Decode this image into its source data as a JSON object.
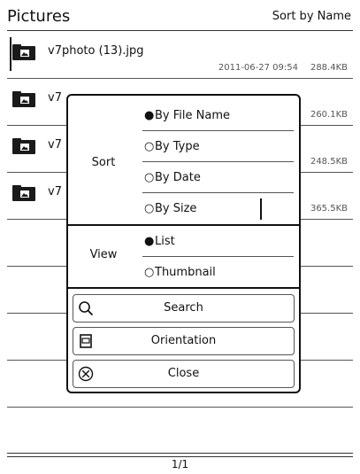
{
  "header": {
    "title": "Pictures",
    "sort_label": "Sort by Name"
  },
  "files": [
    {
      "name": "v7photo (13).jpg",
      "date": "2011-06-27 09:54",
      "size": "288.4KB"
    },
    {
      "name": "v7",
      "date": "",
      "size": "260.1KB"
    },
    {
      "name": "v7",
      "date": "",
      "size": "248.5KB"
    },
    {
      "name": "v7",
      "date": "",
      "size": "365.5KB"
    }
  ],
  "dialog": {
    "sort": {
      "label": "Sort",
      "options": [
        {
          "bullet": "●",
          "label": "By File Name",
          "selected": true
        },
        {
          "bullet": "○",
          "label": "By Type",
          "selected": false
        },
        {
          "bullet": "○",
          "label": "By Date",
          "selected": false
        },
        {
          "bullet": "○",
          "label": "By Size",
          "selected": false
        }
      ]
    },
    "view": {
      "label": "View",
      "options": [
        {
          "bullet": "●",
          "label": "List",
          "selected": true
        },
        {
          "bullet": "○",
          "label": "Thumbnail",
          "selected": false
        }
      ]
    },
    "buttons": {
      "search": {
        "label": "Search",
        "icon": "search-icon"
      },
      "orientation": {
        "label": "Orientation",
        "icon": "orientation-icon"
      },
      "close": {
        "label": "Close",
        "icon": "close-icon"
      }
    }
  },
  "footer": {
    "page": "1/1"
  }
}
